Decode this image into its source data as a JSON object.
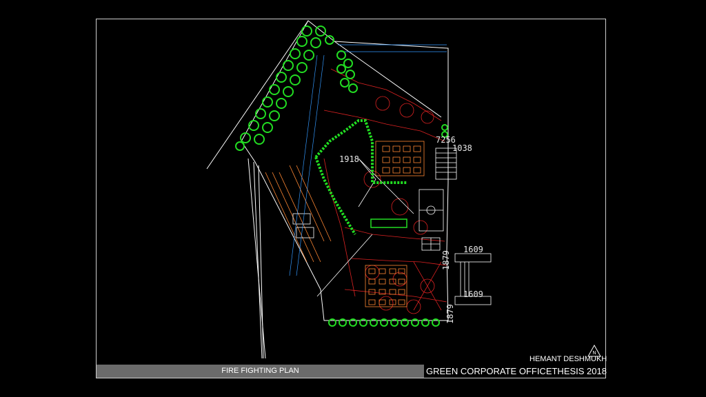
{
  "title_block": {
    "sheet_title": "FIRE FIGHTING PLAN",
    "project_title": "GREEN CORPORATE OFFICETHESIS 2018",
    "author": "HEMANT DESHMUKH",
    "north_label": "N"
  },
  "dimensions": {
    "d1": "7256",
    "d2": "1038",
    "d3": "1918",
    "d4": "1609",
    "d5": "1609",
    "d6": "1879",
    "d7": "1879"
  },
  "colors": {
    "background": "#000000",
    "vegetation": "#22dd22",
    "fire_lines": "#dd2222",
    "walls": "#ffffff",
    "furniture": "#ff8833",
    "frame": "#cfcfcf"
  }
}
